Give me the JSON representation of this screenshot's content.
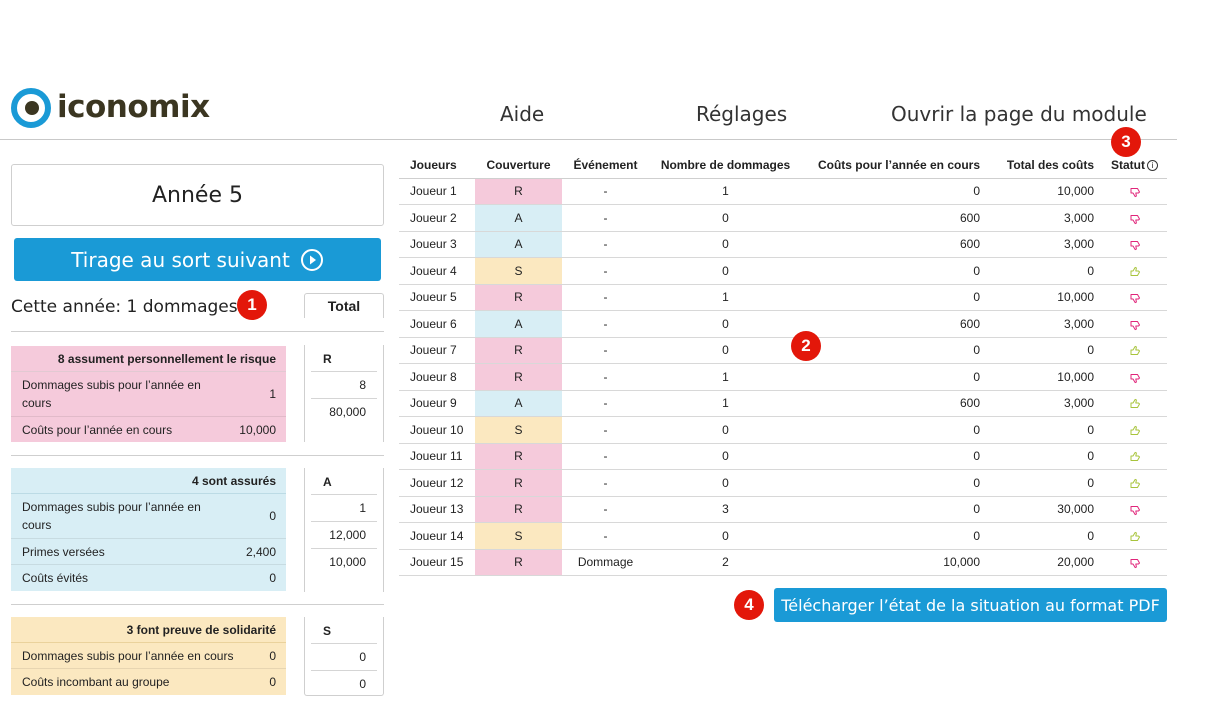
{
  "brand": {
    "name": "iconomix"
  },
  "nav": {
    "help": "Aide",
    "settings": "Réglages",
    "module_page": "Ouvrir la page du module"
  },
  "year_label": "Année 5",
  "draw_button_label": "Tirage au sort suivant",
  "year_damage_text": "Cette année: 1 dommages",
  "total_tab_label": "Total",
  "annotations": {
    "b1": "1",
    "b2": "2",
    "b3": "3",
    "b4": "4"
  },
  "groups": {
    "risk": {
      "title": "8 assument personnellement le risque",
      "rows": [
        {
          "label": "Dommages subis pour l’année en cours",
          "value": "1"
        },
        {
          "label": "Coûts pour l’année en cours",
          "value": "10,000"
        }
      ],
      "total_head": "R",
      "totals": [
        "8",
        "80,000"
      ]
    },
    "insured": {
      "title": "4 sont assurés",
      "rows": [
        {
          "label": "Dommages subis pour l’année en cours",
          "value": "0"
        },
        {
          "label": "Primes versées",
          "value": "2,400"
        },
        {
          "label": "Coûts évités",
          "value": "0"
        }
      ],
      "total_head": "A",
      "totals": [
        "1",
        "12,000",
        "10,000"
      ]
    },
    "solidarity": {
      "title": "3 font preuve de solidarité",
      "rows": [
        {
          "label": "Dommages subis pour l’année en cours",
          "value": "0"
        },
        {
          "label": "Coûts incombant au groupe",
          "value": "0"
        }
      ],
      "total_head": "S",
      "totals": [
        "0",
        "0"
      ]
    }
  },
  "table": {
    "headers": {
      "player": "Joueurs",
      "coverage": "Couverture",
      "event": "Événement",
      "damages": "Nombre de dommages",
      "costs": "Coûts pour l’année en cours",
      "total": "Total des coûts",
      "status": "Statut",
      "info_glyph": "i"
    },
    "rows": [
      {
        "player": "Joueur 1",
        "coverage": "R",
        "event": "-",
        "damages": "1",
        "costs": "0",
        "total": "10,000",
        "status": "down"
      },
      {
        "player": "Joueur 2",
        "coverage": "A",
        "event": "-",
        "damages": "0",
        "costs": "600",
        "total": "3,000",
        "status": "down"
      },
      {
        "player": "Joueur 3",
        "coverage": "A",
        "event": "-",
        "damages": "0",
        "costs": "600",
        "total": "3,000",
        "status": "down"
      },
      {
        "player": "Joueur 4",
        "coverage": "S",
        "event": "-",
        "damages": "0",
        "costs": "0",
        "total": "0",
        "status": "up"
      },
      {
        "player": "Joueur 5",
        "coverage": "R",
        "event": "-",
        "damages": "1",
        "costs": "0",
        "total": "10,000",
        "status": "down"
      },
      {
        "player": "Joueur 6",
        "coverage": "A",
        "event": "-",
        "damages": "0",
        "costs": "600",
        "total": "3,000",
        "status": "down"
      },
      {
        "player": "Joueur 7",
        "coverage": "R",
        "event": "-",
        "damages": "0",
        "costs": "0",
        "total": "0",
        "status": "up"
      },
      {
        "player": "Joueur 8",
        "coverage": "R",
        "event": "-",
        "damages": "1",
        "costs": "0",
        "total": "10,000",
        "status": "down"
      },
      {
        "player": "Joueur 9",
        "coverage": "A",
        "event": "-",
        "damages": "1",
        "costs": "600",
        "total": "3,000",
        "status": "up"
      },
      {
        "player": "Joueur 10",
        "coverage": "S",
        "event": "-",
        "damages": "0",
        "costs": "0",
        "total": "0",
        "status": "up"
      },
      {
        "player": "Joueur 11",
        "coverage": "R",
        "event": "-",
        "damages": "0",
        "costs": "0",
        "total": "0",
        "status": "up"
      },
      {
        "player": "Joueur 12",
        "coverage": "R",
        "event": "-",
        "damages": "0",
        "costs": "0",
        "total": "0",
        "status": "up"
      },
      {
        "player": "Joueur 13",
        "coverage": "R",
        "event": "-",
        "damages": "3",
        "costs": "0",
        "total": "30,000",
        "status": "down"
      },
      {
        "player": "Joueur 14",
        "coverage": "S",
        "event": "-",
        "damages": "0",
        "costs": "0",
        "total": "0",
        "status": "up"
      },
      {
        "player": "Joueur 15",
        "coverage": "R",
        "event": "Dommage",
        "damages": "2",
        "costs": "10,000",
        "total": "20,000",
        "status": "down"
      }
    ]
  },
  "pdf_button_label": "Télécharger l’état de la situation au format PDF",
  "colors": {
    "accent": "#1a9ad6",
    "risk": "#f5cadb",
    "insured": "#d8eef5",
    "solidarity": "#fbe8c0",
    "thumb_down": "#e0257a",
    "thumb_up": "#a8c43c",
    "badge": "#e3170a"
  }
}
